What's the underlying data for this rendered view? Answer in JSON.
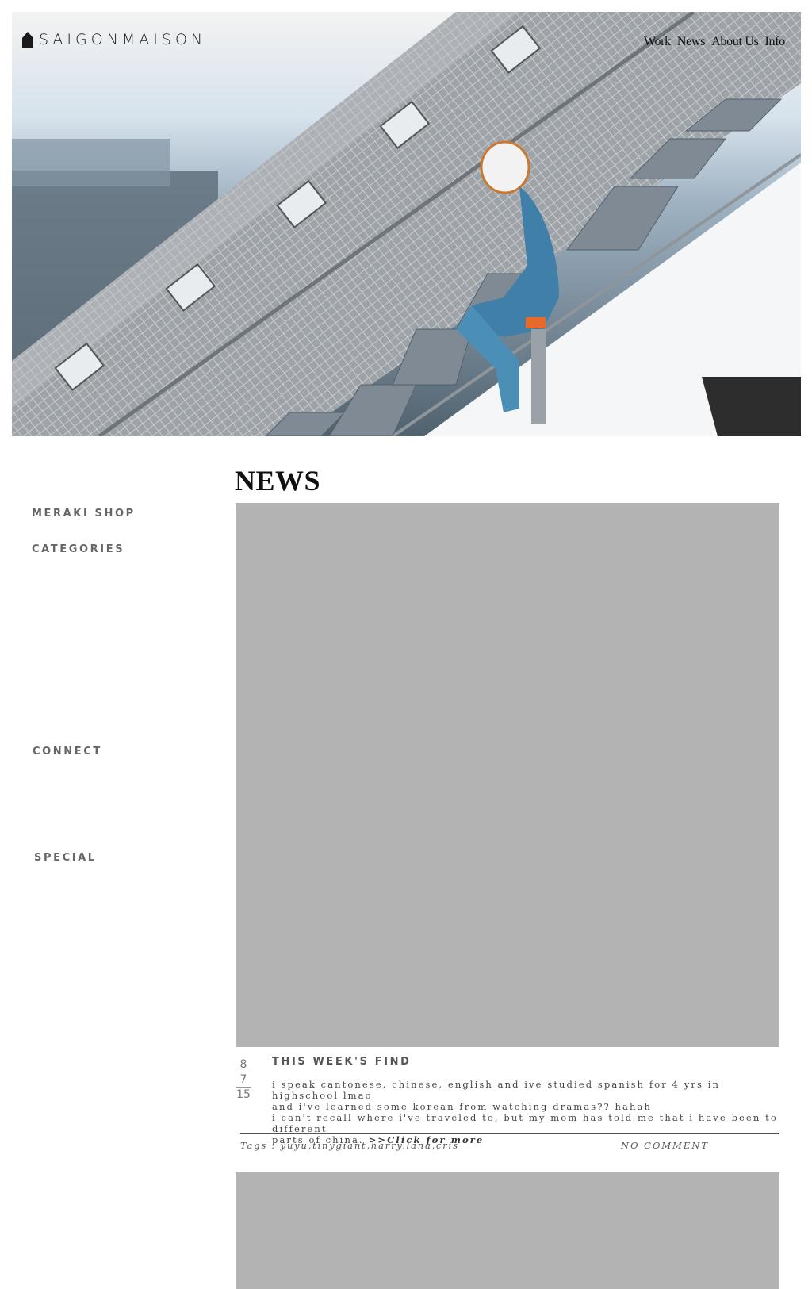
{
  "header": {
    "logo_text": "SAIGONMAISON",
    "nav": [
      "Work",
      "News",
      "About Us",
      "Info"
    ]
  },
  "sidebar": {
    "items": [
      {
        "label": "MERAKI SHOP"
      },
      {
        "label": "CATEGORIES"
      },
      {
        "label": "CONNECT"
      },
      {
        "label": "SPECIAL"
      }
    ]
  },
  "main": {
    "section_title": "NEWS",
    "posts": [
      {
        "date": {
          "month": "8",
          "day": "7",
          "year": "15"
        },
        "title": "THIS WEEK'S FIND",
        "body_lines": [
          "i speak cantonese, chinese, english and ive studied spanish for 4 yrs in highschool lmao",
          "and i've learned some korean from watching dramas?? hahah",
          "i can't recall where i've traveled to, but my mom has told me that i have been to different",
          "parts of china."
        ],
        "more_link": ">>Click for more",
        "tags": "Tags : yuyu,tinygiant,harry,lana,cris",
        "comments": "NO COMMENT"
      }
    ]
  },
  "colors": {
    "image_placeholder": "#b3b3b3",
    "sidebar_text": "#666666",
    "title_text": "#111111"
  }
}
